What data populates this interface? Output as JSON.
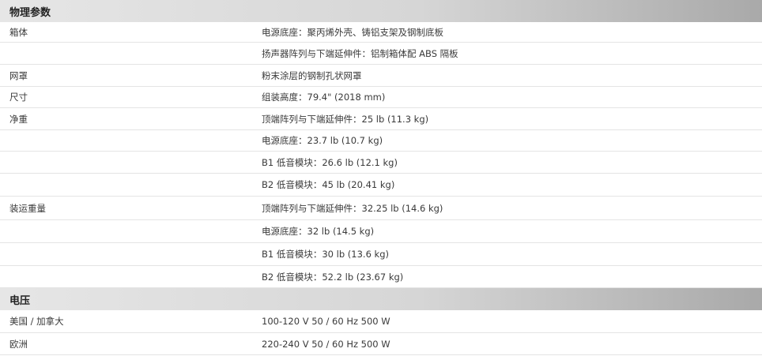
{
  "sections": [
    {
      "title": "物理参数",
      "rows": [
        {
          "label": "箱体",
          "value": "电源底座：聚丙烯外壳、铸铝支架及钢制底板"
        },
        {
          "label": "",
          "value": "扬声器阵列与下端延伸件：铝制箱体配 ABS 隔板"
        },
        {
          "label": "网罩",
          "value": "粉末涂层的钢制孔状网罩"
        },
        {
          "label": "尺寸",
          "value": "组装高度：79.4\" (2018 mm)"
        },
        {
          "label": "净重",
          "value": "顶端阵列与下端延伸件：25 lb (11.3 kg)"
        },
        {
          "label": "",
          "value": "电源底座：23.7 lb (10.7 kg)"
        },
        {
          "label": "",
          "value": "B1 低音模块：26.6 lb (12.1 kg)"
        },
        {
          "label": "",
          "value": "B2 低音模块：45 lb (20.41 kg)"
        },
        {
          "label": "装运重量",
          "value": "顶端阵列与下端延伸件：32.25 lb (14.6 kg)"
        },
        {
          "label": "",
          "value": "电源底座：32 lb (14.5 kg)"
        },
        {
          "label": "",
          "value": "B1 低音模块：30 lb (13.6 kg)"
        },
        {
          "label": "",
          "value": "B2 低音模块：52.2 lb (23.67 kg)"
        }
      ]
    },
    {
      "title": "电压",
      "rows": [
        {
          "label": "美国 / 加拿大",
          "value": "100-120 V 50 / 60 Hz 500 W"
        },
        {
          "label": "欧洲",
          "value": "220-240 V 50 / 60 Hz 500 W"
        }
      ]
    }
  ]
}
